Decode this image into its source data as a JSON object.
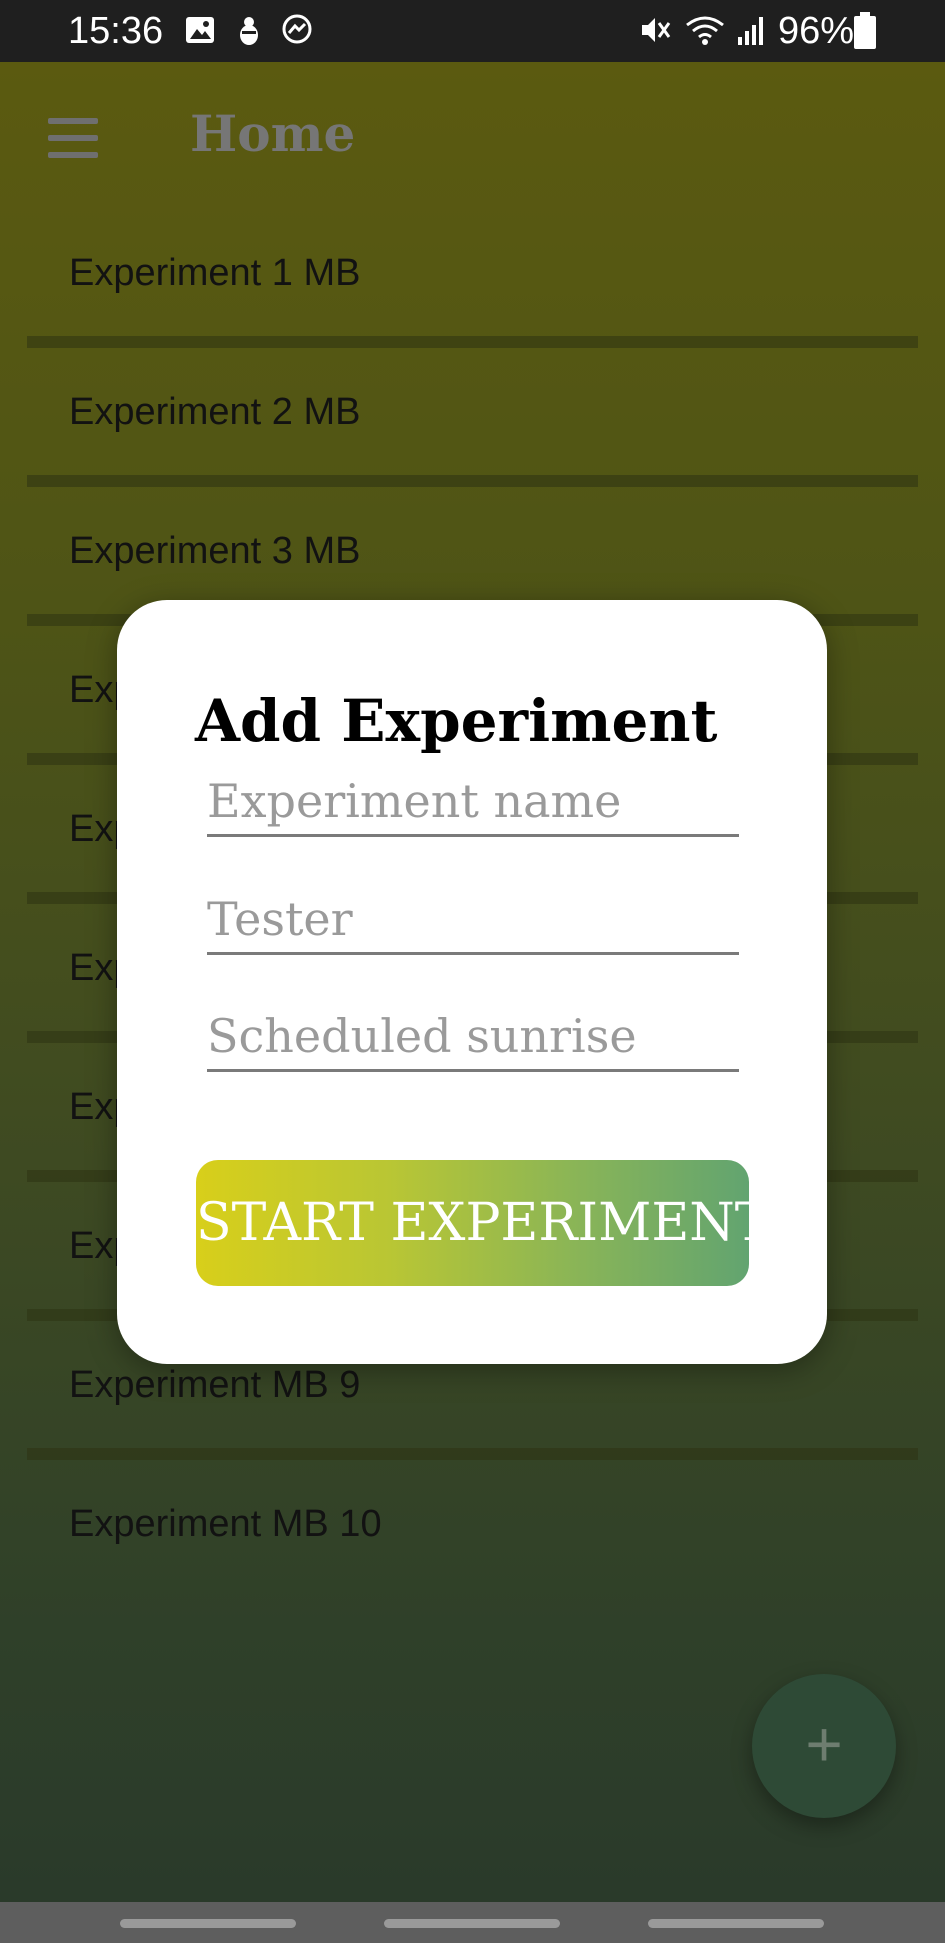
{
  "status_bar": {
    "time": "15:36",
    "notification_icons": [
      "image-icon",
      "bug-icon",
      "messenger-icon"
    ],
    "system_icons": [
      "mute-icon",
      "wifi-icon",
      "signal-icon",
      "battery-icon"
    ],
    "battery_text": "96%"
  },
  "app_bar": {
    "title": "Home",
    "menu_icon": "menu-icon"
  },
  "experiments": [
    {
      "label": "Experiment 1 MB"
    },
    {
      "label": "Experiment 2 MB"
    },
    {
      "label": "Experiment 3 MB"
    },
    {
      "label": "Exp"
    },
    {
      "label": "Exp"
    },
    {
      "label": "Exp"
    },
    {
      "label": "Exp"
    },
    {
      "label": "Exp"
    },
    {
      "label": "Experiment MB 9"
    },
    {
      "label": "Experiment MB 10"
    }
  ],
  "fab": {
    "icon": "plus-icon",
    "glyph": "+"
  },
  "dialog": {
    "title": "Add Experiment",
    "fields": {
      "name": {
        "placeholder": "Experiment name",
        "value": ""
      },
      "tester": {
        "placeholder": "Tester",
        "value": ""
      },
      "sunrise": {
        "placeholder": "Scheduled sunrise",
        "value": ""
      }
    },
    "start_button": "START EXPERIMENT"
  },
  "colors": {
    "status_bar": "#1f1f1f",
    "button_gradient_start": "#d8cf1a",
    "button_gradient_end": "#62a470",
    "dialog_background": "#ffffff"
  }
}
